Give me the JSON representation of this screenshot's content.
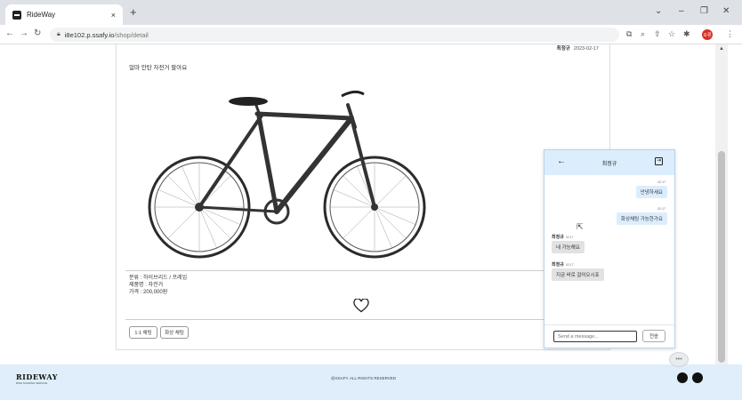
{
  "browser": {
    "tab_title": "RideWay",
    "tab_close": "×",
    "new_tab": "+",
    "url_host": "i8e102.p.ssafy.io",
    "url_path": "/shop/detail",
    "profile_initials": "오류"
  },
  "post": {
    "author": "최정규",
    "date": "2023-02-17",
    "description": "얼마 안탄 자전거 팔아요",
    "info_category": "분류 : 하이브리드 / 프레임",
    "info_name": "제품명 : 자전거",
    "info_price": "가격 : 200,000원",
    "button_chat": "1:1 채팅",
    "button_video": "화상 채팅"
  },
  "chat": {
    "title": "최정규",
    "back": "←",
    "exit": "⇥",
    "messages": [
      {
        "side": "right",
        "time": "02:17",
        "text": "안녕하세요"
      },
      {
        "side": "right",
        "time": "02:17",
        "text": "화상채팅 가능한가요"
      },
      {
        "side": "left",
        "sender": "최정규",
        "time": "02:17",
        "text": "네 가능해요"
      },
      {
        "side": "left",
        "sender": "최정규",
        "time": "02:17",
        "text": "지금 바로 걸어오시죠"
      }
    ],
    "input_placeholder": "Send a message...",
    "send_label": "전송"
  },
  "footer": {
    "logo": "RIDEWAY",
    "logo_sub": "BIKE SHARING SERVICE",
    "copyright": "@SSAFY. ALL RIGHTS RESERVED",
    "fab": "•••"
  }
}
